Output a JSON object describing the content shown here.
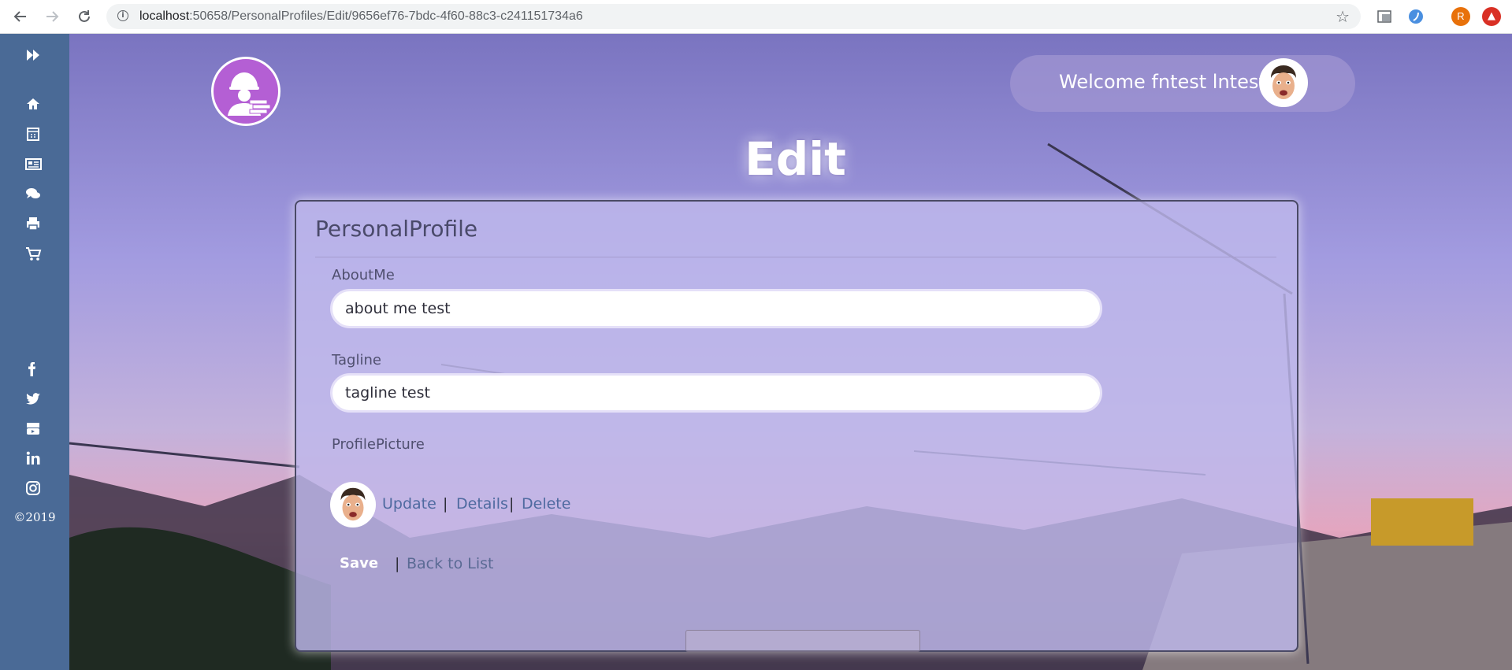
{
  "browser": {
    "url_host": "localhost",
    "url_path": ":50658/PersonalProfiles/Edit/9656ef76-7bdc-4f60-88c3-c241151734a6",
    "profile_initial": "R",
    "back_icon": "arrow-left-icon",
    "forward_icon": "arrow-right-icon",
    "reload_icon": "reload-icon",
    "star_icon": "star-icon"
  },
  "sidebar": {
    "toggle_icon": "double-chevron-right-icon",
    "nav_icons": [
      "home-icon",
      "calendar-icon",
      "newspaper-icon",
      "comments-icon",
      "print-icon",
      "cart-icon"
    ],
    "social_icons": [
      "facebook-icon",
      "twitter-icon",
      "youtube-icon",
      "linkedin-icon",
      "instagram-icon"
    ],
    "copyright": "©2019",
    "color": "#4a6a96"
  },
  "header": {
    "welcome": "Welcome fntest lntest"
  },
  "page_title": "Edit",
  "form": {
    "heading": "PersonalProfile",
    "about_label": "AboutMe",
    "about_value": "about me test",
    "tagline_label": "Tagline",
    "tagline_value": "tagline test",
    "picture_label": "ProfilePicture",
    "update_link": "Update",
    "details_link": "Details",
    "delete_link": "Delete",
    "separator": "|",
    "save_button": "Save",
    "back_link": "Back to List"
  },
  "colors": {
    "accent_link": "#4f6aa0",
    "logo": "#b45fd4"
  }
}
